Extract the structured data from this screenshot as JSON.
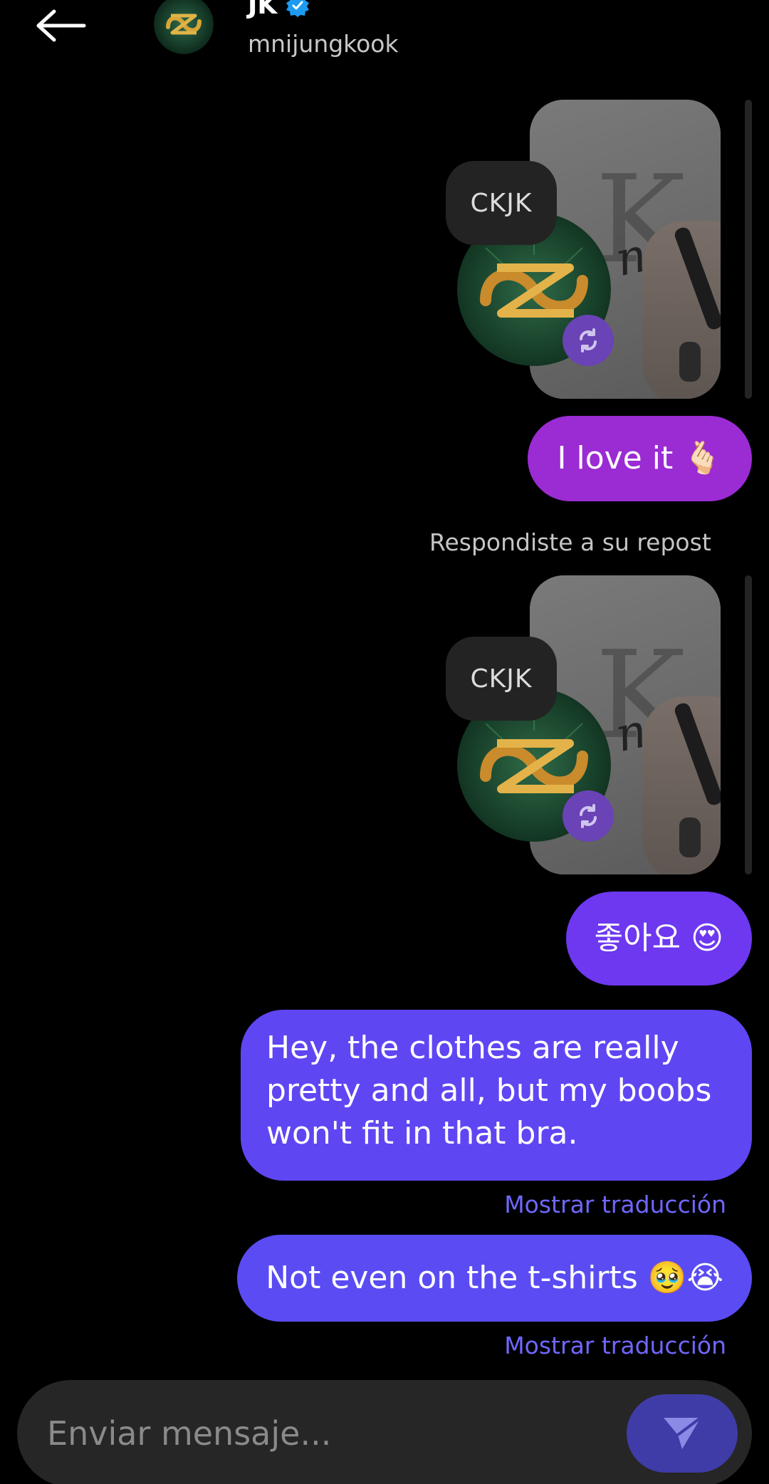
{
  "header": {
    "name": "JK",
    "username": "mnijungkook"
  },
  "messages": {
    "repost_1": {
      "label": "CKJK"
    },
    "bubble_1": {
      "text": "I love it",
      "emoji": "🫰🏻"
    },
    "reply_note": "Respondiste a su repost",
    "repost_2": {
      "label": "CKJK"
    },
    "bubble_2": {
      "text": "좋아요",
      "emoji": "😍"
    },
    "bubble_3": {
      "text": "Hey, the clothes are really pretty and all, but my boobs won't fit in that bra.",
      "translate": "Mostrar traducción"
    },
    "bubble_4": {
      "text": "Not even on the t-shirts",
      "emoji": "🥹😭",
      "translate": "Mostrar traducción"
    }
  },
  "composer": {
    "placeholder": "Enviar mensaje..."
  },
  "colors": {
    "bubble_violet": "#9b2bd3",
    "bubble_purple": "#6d38f0",
    "bubble_blue": "#5f46f3",
    "link": "#6f67ff",
    "verified": "#1d9bf0"
  },
  "icons": [
    "back-arrow-icon",
    "verified-badge-icon",
    "repost-icon",
    "send-icon"
  ]
}
